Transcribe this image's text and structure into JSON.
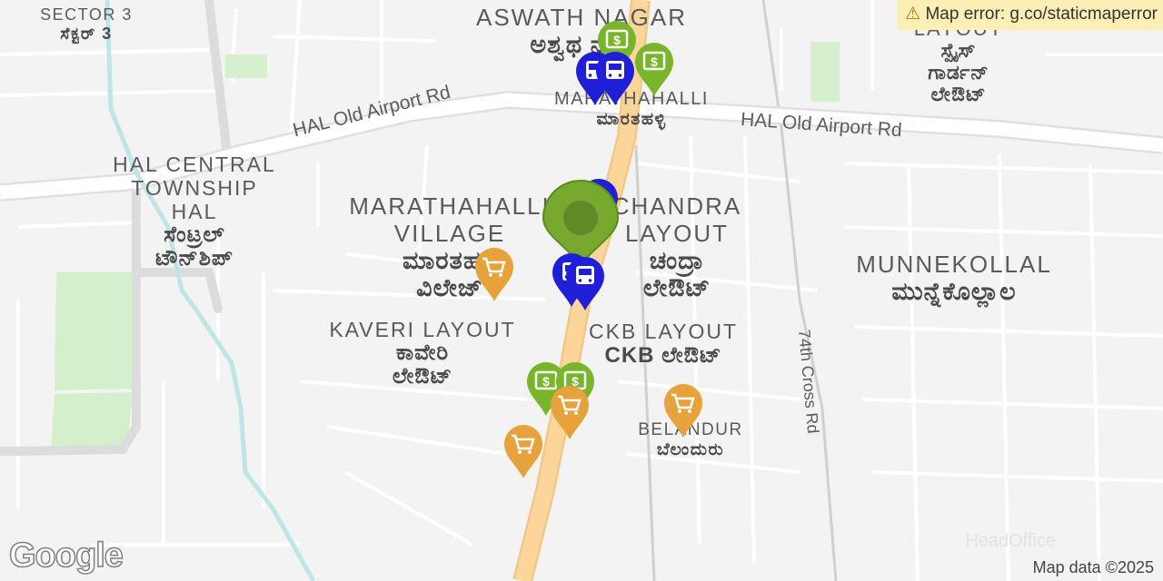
{
  "error": {
    "icon": "warning-icon",
    "text": "Map error: g.co/staticmaperror"
  },
  "attribution": "Map data ©2025",
  "logo": "Google",
  "watermark": "HeadOffice",
  "areas": {
    "sector3": {
      "en": "SECTOR 3",
      "kn": "ಸೆಕ್ಟರ್ 3"
    },
    "aswath": {
      "en": "ASWATH NAGAR",
      "kn": "ಅಶ್ವಥ ನಗರ"
    },
    "hal_central": {
      "en1": "HAL CENTRAL",
      "en2": "TOWNSHIP",
      "en3": "HAL",
      "kn1": "ಸೆಂಟ್ರಲ್",
      "kn2": "ಟೌನ್‌ಶಿಪ್"
    },
    "marathahalli": {
      "en": "MARATHAHALLI",
      "kn": "ಮಾರತಹಳ್ಳಿ"
    },
    "marathahalli_village": {
      "en1": "MARATHAHALLI",
      "en2": "VILLAGE",
      "kn1": "ಮಾರತಹಳ್ಳಿ",
      "kn2": "ವಿಲೇಜ್"
    },
    "chandra": {
      "en1": "CHANDRA",
      "en2": "LAYOUT",
      "kn1": "ಚಂದ್ರಾ",
      "kn2": "ಲೇಔಟ್"
    },
    "munnekollal": {
      "en": "MUNNEKOLLAL",
      "kn": "ಮುನ್ನೆಕೊಲ್ಲಾಲ"
    },
    "kaveri": {
      "en": "KAVERI LAYOUT",
      "kn1": "ಕಾವೇರಿ",
      "kn2": "ಲೇಔಟ್"
    },
    "ckb": {
      "en": "CKB LAYOUT",
      "kn": "CKB ಲೇಔಟ್"
    },
    "belandur": {
      "en": "BELANDUR",
      "kn": "ಬೆಲಂದುರು"
    },
    "spices": {
      "en": "LAYOUT",
      "kn1": "ಸ್ಪೈಸ್",
      "kn2": "ಗಾರ್ಡನ್",
      "kn3": "ಲೇಔಟ್"
    }
  },
  "roads": {
    "hal_left": "HAL Old Airport Rd",
    "hal_right": "HAL Old Airport Rd",
    "cross74": "74th Cross Rd"
  },
  "markers": {
    "center": {
      "type": "location",
      "color": "#76a92d"
    },
    "bus": {
      "type": "bus-stop",
      "color": "#1f1fd8"
    },
    "atm": {
      "type": "atm",
      "color": "#79b52a"
    },
    "shop": {
      "type": "shopping-cart",
      "color": "#e8a23b"
    }
  }
}
